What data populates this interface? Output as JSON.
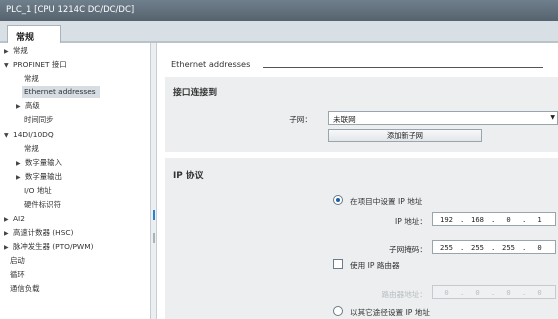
{
  "window": {
    "title": "PLC_1 [CPU 1214C DC/DC/DC]"
  },
  "tabs": [
    {
      "label": "常规"
    }
  ],
  "nav": {
    "items": [
      {
        "label": "常规",
        "expander": "collapsed"
      },
      {
        "label": "PROFINET 接口",
        "expander": "expanded"
      },
      {
        "label": "常规",
        "expander": ""
      },
      {
        "label": "Ethernet addresses",
        "expander": "",
        "selected": true
      },
      {
        "label": "高级",
        "expander": "collapsed"
      },
      {
        "label": "时间同步",
        "expander": ""
      },
      {
        "label": "14DI/10DQ",
        "expander": "expanded"
      },
      {
        "label": "常规",
        "expander": ""
      },
      {
        "label": "数字量输入",
        "expander": "collapsed"
      },
      {
        "label": "数字量输出",
        "expander": "collapsed"
      },
      {
        "label": "I/O 地址",
        "expander": ""
      },
      {
        "label": "硬件标识符",
        "expander": ""
      },
      {
        "label": "AI2",
        "expander": "collapsed"
      },
      {
        "label": "高速计数器 (HSC)",
        "expander": "collapsed"
      },
      {
        "label": "脉冲发生器 (PTO/PWM)",
        "expander": "collapsed"
      },
      {
        "label": "启动",
        "expander": ""
      },
      {
        "label": "循环",
        "expander": ""
      },
      {
        "label": "通信负载",
        "expander": ""
      }
    ]
  },
  "main": {
    "section_title": "Ethernet addresses",
    "interface": {
      "title": "接口连接到",
      "subnet_label": "子网：",
      "subnet_value": "未联网",
      "add_subnet_button": "添加新子网"
    },
    "ip": {
      "title": "IP 协议",
      "set_in_project_label": "在项目中设置 IP 地址",
      "ip_label": "IP 地址：",
      "ip_value": [
        "192",
        "168",
        "0",
        "1"
      ],
      "mask_label": "子网掩码：",
      "mask_value": [
        "255",
        "255",
        "255",
        "0"
      ],
      "use_router_label": "使用 IP 路由器",
      "router_label": "路由器地址：",
      "router_value": [
        "0",
        "0",
        "0",
        "0"
      ],
      "other_method_label": "以其它途径设置 IP 地址"
    }
  },
  "colors": {
    "titlebar": "#5f6d78",
    "panel": "#eceeef",
    "selection": "#d6dde3",
    "accent": "#2f7fd0"
  },
  "icons": {
    "dropdown": "triangle-down",
    "collapsed": "triangle-right",
    "expanded": "triangle-down"
  }
}
